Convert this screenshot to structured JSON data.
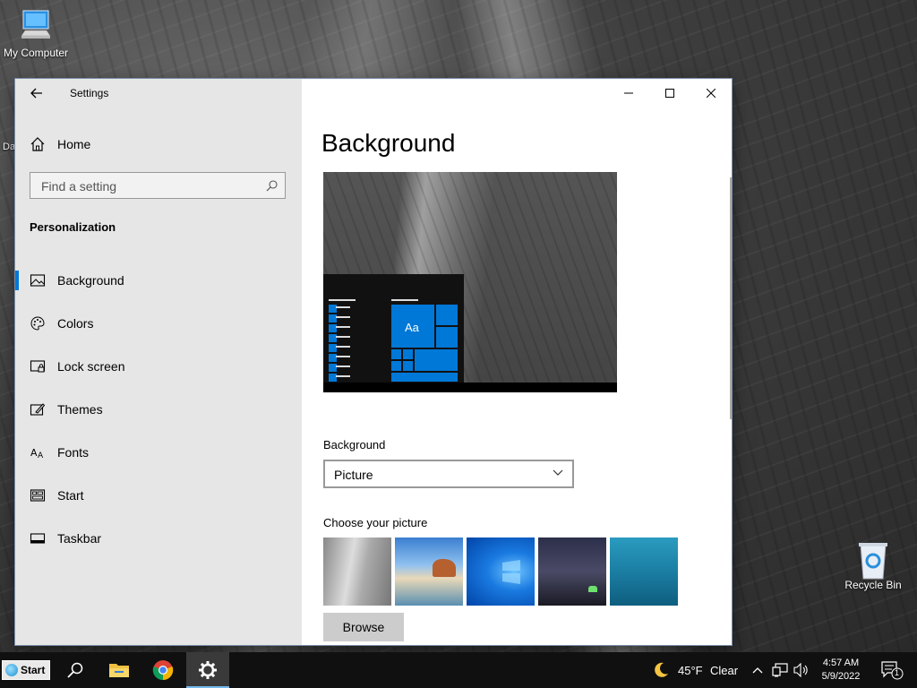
{
  "desktop": {
    "icons": [
      {
        "label": "My Computer"
      },
      {
        "label": "Recycle Bin"
      }
    ],
    "stray_text": "Da"
  },
  "window": {
    "title": "Settings",
    "nav": {
      "home_label": "Home",
      "search_placeholder": "Find a setting",
      "section_title": "Personalization",
      "items": [
        {
          "label": "Background",
          "icon": "picture-icon",
          "selected": true
        },
        {
          "label": "Colors",
          "icon": "palette-icon"
        },
        {
          "label": "Lock screen",
          "icon": "lock-screen-icon"
        },
        {
          "label": "Themes",
          "icon": "themes-icon"
        },
        {
          "label": "Fonts",
          "icon": "fonts-icon"
        },
        {
          "label": "Start",
          "icon": "start-icon"
        },
        {
          "label": "Taskbar",
          "icon": "taskbar-icon"
        }
      ]
    },
    "content": {
      "page_title": "Background",
      "preview_tile_text": "Aa",
      "background_label": "Background",
      "background_value": "Picture",
      "choose_label": "Choose your picture",
      "browse_label": "Browse"
    }
  },
  "taskbar": {
    "start_label": "Start",
    "weather_temp": "45°F",
    "weather_desc": "Clear",
    "time": "4:57 AM",
    "date": "5/9/2022",
    "notification_count": "1"
  },
  "colors": {
    "accent": "#0078d7",
    "sidebar_bg": "#e6e6e6",
    "taskbar_bg": "#101010"
  }
}
